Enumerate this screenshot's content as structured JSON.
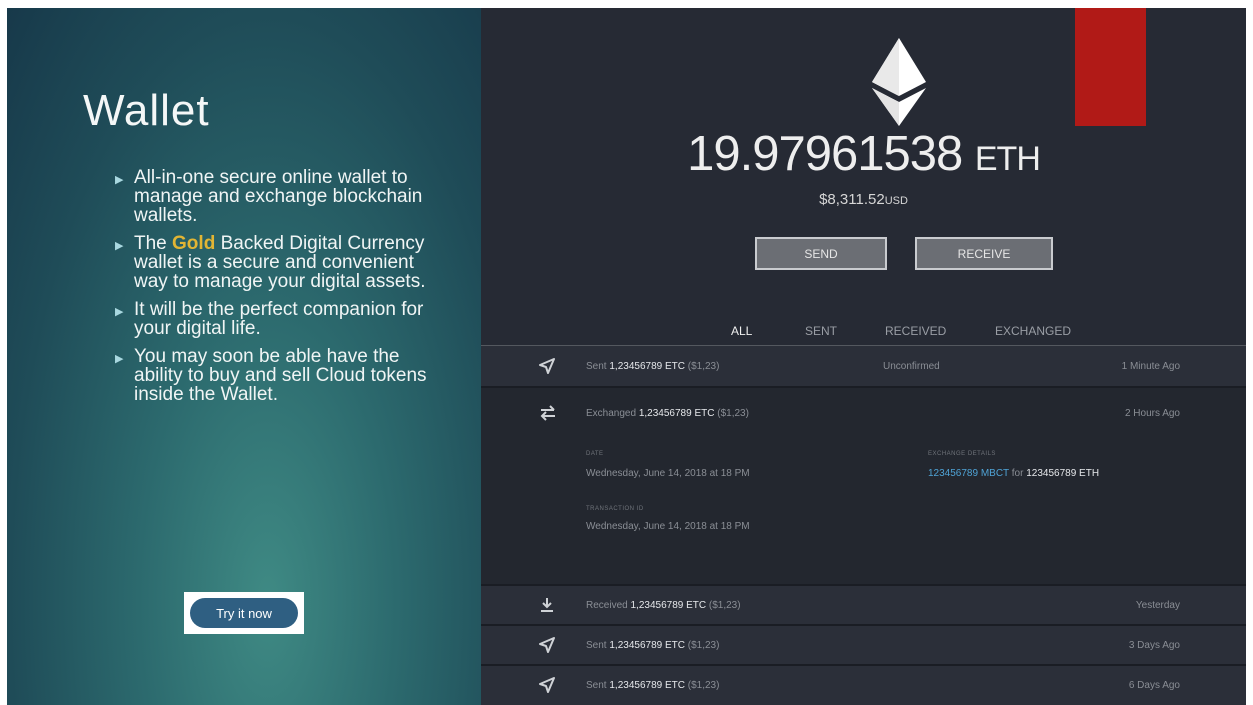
{
  "left": {
    "title": "Wallet",
    "bullets": {
      "b1": "All-in-one secure online wallet to manage and exchange blockchain wallets.",
      "b2_pre": "The ",
      "b2_gold": "Gold",
      "b2_post": " Backed Digital Currency wallet is a secure and convenient way to manage your digital assets.",
      "b3": "It will be the perfect companion for your digital life.",
      "b4": "You may soon be able have the ability to buy and sell Cloud tokens inside the Wallet."
    },
    "try_button": "Try it now",
    "gold_color": "#e2b534"
  },
  "wallet": {
    "balance": "19.97961538",
    "balance_unit": "ETH",
    "usd_value": "$8,311.52",
    "usd_unit": "USD",
    "send_label": "SEND",
    "receive_label": "RECEIVE",
    "tabs": {
      "all": "ALL",
      "sent": "SENT",
      "received": "RECEIVED",
      "exchanged": "EXCHANGED"
    },
    "active_tab": "ALL",
    "accent_red": "#b11a17",
    "transactions": [
      {
        "icon": "send-icon",
        "type": "Sent",
        "amount": "1,23456789 ETC",
        "usd": "($1,23)",
        "status": "Unconfirmed",
        "time": "1 Minute Ago"
      },
      {
        "icon": "exchange-icon",
        "type": "Exchanged",
        "amount": "1,23456789 ETC",
        "usd": "($1,23)",
        "status": "",
        "time": "2 Hours Ago",
        "details": {
          "date_label": "DATE",
          "date_value": "Wednesday, June 14, 2018 at 18 PM",
          "exchange_label": "EXCHANGE DETAILS",
          "exchange_from": "123456789 MBCT",
          "exchange_for": "for",
          "exchange_to": "123456789 ETH",
          "tx_label": "TRANSACTION ID",
          "tx_value": "Wednesday, June 14, 2018 at 18 PM"
        }
      },
      {
        "icon": "download-icon",
        "type": "Received",
        "amount": "1,23456789 ETC",
        "usd": "($1,23)",
        "status": "",
        "time": "Yesterday"
      },
      {
        "icon": "send-icon",
        "type": "Sent",
        "amount": "1,23456789 ETC",
        "usd": "($1,23)",
        "status": "",
        "time": "3 Days Ago"
      },
      {
        "icon": "send-icon",
        "type": "Sent",
        "amount": "1,23456789 ETC",
        "usd": "($1,23)",
        "status": "",
        "time": "6 Days Ago"
      }
    ]
  }
}
